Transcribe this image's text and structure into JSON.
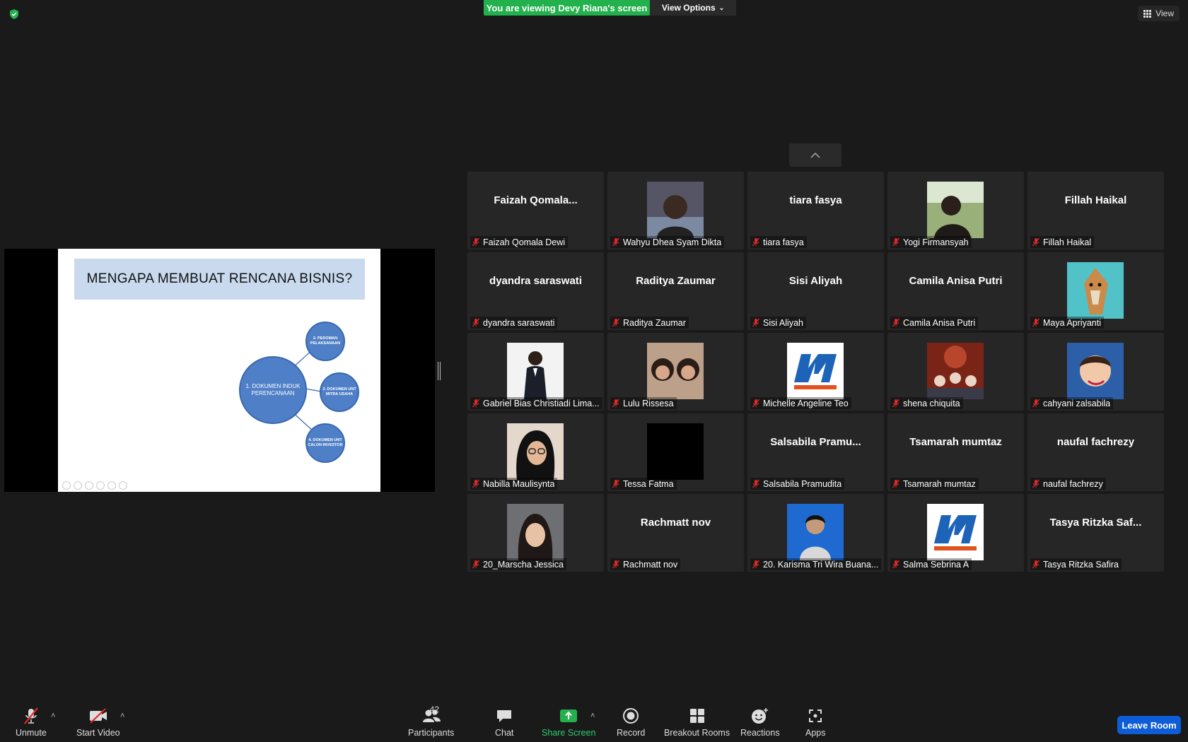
{
  "top": {
    "banner": "You are viewing Devy Riana's screen",
    "view_options": "View Options",
    "view": "View"
  },
  "slide": {
    "title": "MENGAPA MEMBUAT RENCANA BISNIS?",
    "node_main": "1. DOKUMEN INDUK PERENCANAAN",
    "node_2": "2. PEDOMAN PELAKSANAAN",
    "node_3": "3. DOKUMEN UNT MITRA USAHA",
    "node_4": "4. DOKUMEN UNT CALON INVESTOR"
  },
  "participants": [
    {
      "label": "Faizah Qomala Dewi",
      "big": "Faizah  Qomala...",
      "photo": null
    },
    {
      "label": "Wahyu Dhea Syam Dikta",
      "big": null,
      "photo": "portrait-dark"
    },
    {
      "label": "tiara fasya",
      "big": "tiara fasya",
      "photo": null
    },
    {
      "label": "Yogi Firmansyah",
      "big": null,
      "photo": "portrait-outdoor"
    },
    {
      "label": "Fillah Haikal",
      "big": "Fillah Haikal",
      "photo": null
    },
    {
      "label": "dyandra saraswati",
      "big": "dyandra saraswati",
      "photo": null
    },
    {
      "label": "Raditya Zaumar",
      "big": "Raditya Zaumar",
      "photo": null
    },
    {
      "label": "Sisi Aliyah",
      "big": "Sisi Aliyah",
      "photo": null
    },
    {
      "label": "Camila Anisa Putri",
      "big": "Camila Anisa Putri",
      "photo": null
    },
    {
      "label": "Maya Apriyanti",
      "big": null,
      "photo": "giraffe-illustration"
    },
    {
      "label": "Gabriel Bias Christiadi Lima...",
      "big": null,
      "photo": "portrait-suit"
    },
    {
      "label": "Lulu Rissesa",
      "big": null,
      "photo": "portrait-duo"
    },
    {
      "label": "Michelle Angeline Teo",
      "big": null,
      "photo": "ilkom-logo"
    },
    {
      "label": "shena chiquita",
      "big": null,
      "photo": "group-photo"
    },
    {
      "label": "cahyani zalsabila",
      "big": null,
      "photo": "child-photo"
    },
    {
      "label": "Nabilla Maulisynta",
      "big": null,
      "photo": "portrait-hijab"
    },
    {
      "label": "Tessa Fatma",
      "big": null,
      "photo": "black-square"
    },
    {
      "label": "Salsabila Pramudita",
      "big": "Salsabila  Pramu...",
      "photo": null
    },
    {
      "label": "Tsamarah mumtaz",
      "big": "Tsamarah mumtaz",
      "photo": null
    },
    {
      "label": "naufal fachrezy",
      "big": "naufal fachrezy",
      "photo": null
    },
    {
      "label": "20_Marscha Jessica",
      "big": null,
      "photo": "portrait-girl"
    },
    {
      "label": "Rachmatt nov",
      "big": "Rachmatt nov",
      "photo": null
    },
    {
      "label": "20. Karisma Tri Wira Buana...",
      "big": null,
      "photo": "portrait-blue"
    },
    {
      "label": "Salma Sebrina A",
      "big": null,
      "photo": "ilkom-logo"
    },
    {
      "label": "Tasya Ritzka Safira",
      "big": "Tasya Ritzka Saf...",
      "photo": null
    }
  ],
  "toolbar": {
    "unmute": "Unmute",
    "start_video": "Start Video",
    "participants": "Participants",
    "participants_count": "42",
    "chat": "Chat",
    "share_screen": "Share Screen",
    "record": "Record",
    "breakout_rooms": "Breakout Rooms",
    "reactions": "Reactions",
    "apps": "Apps",
    "leave_room": "Leave Room"
  },
  "colors": {
    "share_green": "#23b14d",
    "leave_blue": "#0e5cd6",
    "muted_red": "#e02828",
    "tile_bg": "#262626"
  }
}
